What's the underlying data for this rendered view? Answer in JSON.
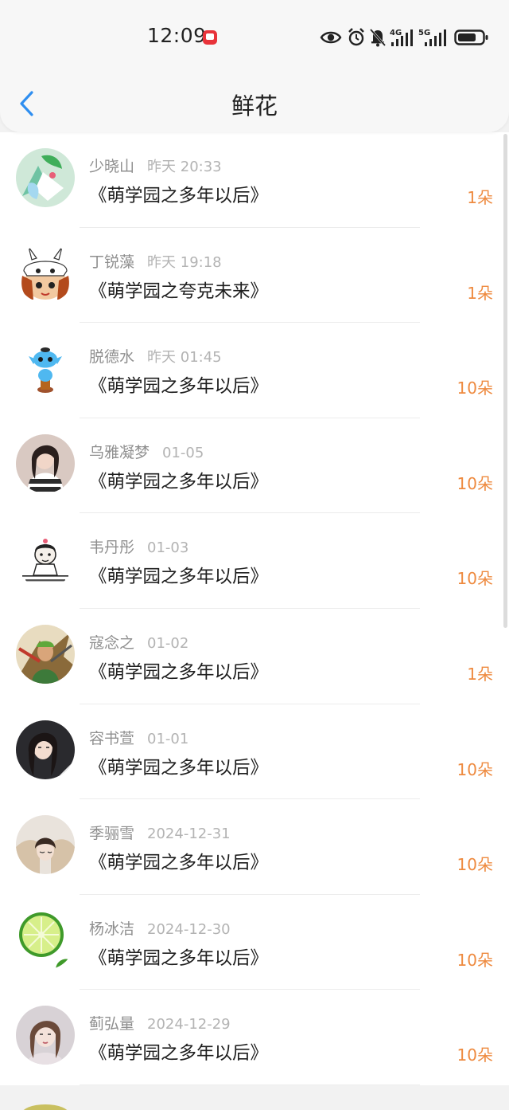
{
  "status_bar": {
    "time": "12:09",
    "icons": [
      "app-notification-icon",
      "eye-icon",
      "alarm-icon",
      "mute-icon",
      "signal-4g-icon",
      "signal-5g-icon",
      "battery-icon"
    ]
  },
  "nav": {
    "title": "鲜花",
    "back_icon": "back-chevron-icon"
  },
  "colors": {
    "accent_blue": "#2e8ef0",
    "count_orange": "#ee8a3f",
    "meta_gray": "#8f8f8f"
  },
  "records": [
    {
      "name": "少晓山",
      "date": "昨天 20:33",
      "book": "《萌学园之多年以后》",
      "count": "1朵",
      "avatar": "anime-avatar"
    },
    {
      "name": "丁锐藻",
      "date": "昨天 19:18",
      "book": "《萌学园之夸克未来》",
      "count": "1朵",
      "avatar": "bunny-cartoon-avatar"
    },
    {
      "name": "脱德水",
      "date": "昨天 01:45",
      "book": "《萌学园之多年以后》",
      "count": "10朵",
      "avatar": "blue-figure-avatar"
    },
    {
      "name": "乌雅凝梦",
      "date": "01-05",
      "book": "《萌学园之多年以后》",
      "count": "10朵",
      "avatar": "photo-avatar"
    },
    {
      "name": "韦丹彤",
      "date": "01-03",
      "book": "《萌学园之多年以后》",
      "count": "10朵",
      "avatar": "sketch-avatar"
    },
    {
      "name": "寇念之",
      "date": "01-02",
      "book": "《萌学园之多年以后》",
      "count": "1朵",
      "avatar": "anime-warrior-avatar"
    },
    {
      "name": "容书萱",
      "date": "01-01",
      "book": "《萌学园之多年以后》",
      "count": "10朵",
      "avatar": "photo-avatar"
    },
    {
      "name": "季骊雪",
      "date": "2024-12-31",
      "book": "《萌学园之多年以后》",
      "count": "10朵",
      "avatar": "photo-avatar"
    },
    {
      "name": "杨冰洁",
      "date": "2024-12-30",
      "book": "《萌学园之多年以后》",
      "count": "10朵",
      "avatar": "lime-avatar"
    },
    {
      "name": "蓟弘量",
      "date": "2024-12-29",
      "book": "《萌学园之多年以后》",
      "count": "10朵",
      "avatar": "photo-avatar"
    }
  ]
}
